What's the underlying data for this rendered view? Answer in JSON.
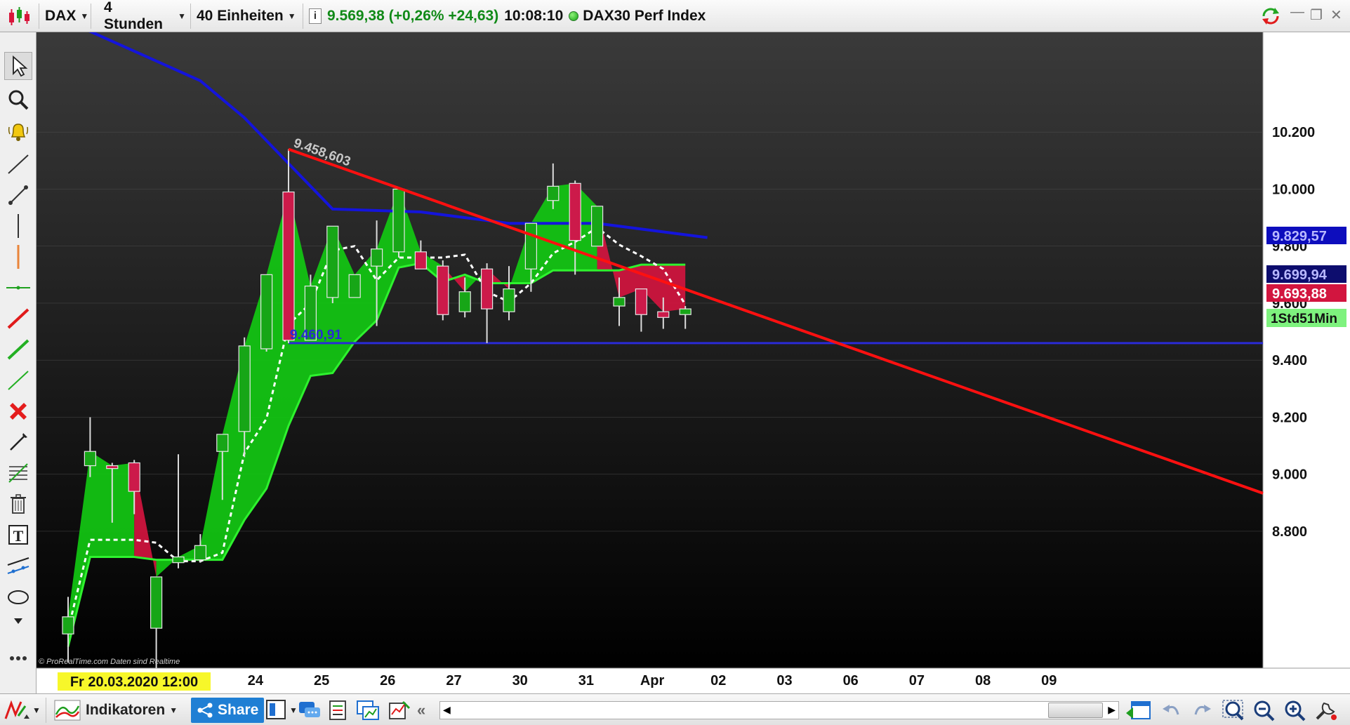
{
  "toolbar": {
    "symbol": "DAX",
    "timeframe": "4 Stunden",
    "units": "40 Einheiten",
    "price": "9.569,38",
    "change": "(+0,26% +24,63)",
    "time": "10:08:10",
    "instrument_name": "DAX30 Perf Index"
  },
  "bottom": {
    "indicators_label": "Indikatoren",
    "share_label": "Share",
    "collapse_label": "«"
  },
  "colors": {
    "bull": "#17a617",
    "bear": "#cc1a4a",
    "cloud_green": "#12c812",
    "cloud_red": "#d2153f",
    "trendline": "#ff1010",
    "ma_blue": "#1414dc",
    "support_line": "#2a2ad6",
    "kijun": "#2ef22e",
    "tenkan": "#ffffff",
    "chikou_dashed": "#6a6af0"
  },
  "chart_data": {
    "type": "candlestick",
    "y_range": [
      8320,
      10550
    ],
    "y_ticks": [
      "10.200",
      "10.000",
      "9.800",
      "9.600",
      "9.400",
      "9.200",
      "9.000",
      "8.800"
    ],
    "x_labels": [
      "Fr 20.03.2020 12:00",
      "24",
      "25",
      "26",
      "27",
      "30",
      "31",
      "Apr",
      "02",
      "03",
      "06",
      "07",
      "08",
      "09"
    ],
    "candles": [
      {
        "o": 8440,
        "h": 8570,
        "l": 8340,
        "c": 8500
      },
      {
        "o": 9030,
        "h": 9200,
        "l": 8990,
        "c": 9080
      },
      {
        "o": 9030,
        "h": 9040,
        "l": 8830,
        "c": 9020
      },
      {
        "o": 9040,
        "h": 9050,
        "l": 8860,
        "c": 8940
      },
      {
        "o": 8460,
        "h": 8560,
        "l": 8320,
        "c": 8640
      },
      {
        "o": 8690,
        "h": 9070,
        "l": 8670,
        "c": 8710
      },
      {
        "o": 8700,
        "h": 8790,
        "l": 8690,
        "c": 8750
      },
      {
        "o": 9080,
        "h": 9130,
        "l": 8910,
        "c": 9140
      },
      {
        "o": 9150,
        "h": 9480,
        "l": 9060,
        "c": 9450
      },
      {
        "o": 9440,
        "h": 9700,
        "l": 9430,
        "c": 9700
      },
      {
        "o": 9990,
        "h": 10140,
        "l": 9460,
        "c": 9470
      },
      {
        "o": 9470,
        "h": 9700,
        "l": 9470,
        "c": 9660
      },
      {
        "o": 9620,
        "h": 9870,
        "l": 9600,
        "c": 9870
      },
      {
        "o": 9620,
        "h": 9700,
        "l": 9620,
        "c": 9700
      },
      {
        "o": 9730,
        "h": 9890,
        "l": 9520,
        "c": 9790
      },
      {
        "o": 9780,
        "h": 10000,
        "l": 9760,
        "c": 10000
      },
      {
        "o": 9780,
        "h": 9820,
        "l": 9720,
        "c": 9720
      },
      {
        "o": 9730,
        "h": 9750,
        "l": 9540,
        "c": 9560
      },
      {
        "o": 9570,
        "h": 9690,
        "l": 9550,
        "c": 9640
      },
      {
        "o": 9720,
        "h": 9740,
        "l": 9460,
        "c": 9580
      },
      {
        "o": 9570,
        "h": 9730,
        "l": 9540,
        "c": 9650
      },
      {
        "o": 9720,
        "h": 9880,
        "l": 9640,
        "c": 9880
      },
      {
        "o": 9960,
        "h": 10090,
        "l": 9930,
        "c": 10010
      },
      {
        "o": 10020,
        "h": 10030,
        "l": 9700,
        "c": 9820
      },
      {
        "o": 9800,
        "h": 9940,
        "l": 9800,
        "c": 9940
      },
      {
        "o": 9590,
        "h": 9690,
        "l": 9520,
        "c": 9620
      },
      {
        "o": 9650,
        "h": 9650,
        "l": 9500,
        "c": 9560
      },
      {
        "o": 9570,
        "h": 9620,
        "l": 9510,
        "c": 9550
      },
      {
        "o": 9560,
        "h": 9590,
        "l": 9510,
        "c": 9580
      }
    ],
    "annotations": {
      "peak_label": "9.458,603",
      "support_label": "9.460,91",
      "support_value": 9460
    },
    "price_badges": [
      {
        "label": "9.829,57",
        "value": 9829.57
      },
      {
        "label": "9.699,94",
        "value": 9699.94
      },
      {
        "label": "9.693,88",
        "value": 9693.88
      }
    ],
    "countdown_label": "1Std51Min",
    "watermark": "© ProRealTime.com  Daten sind Realtime"
  }
}
